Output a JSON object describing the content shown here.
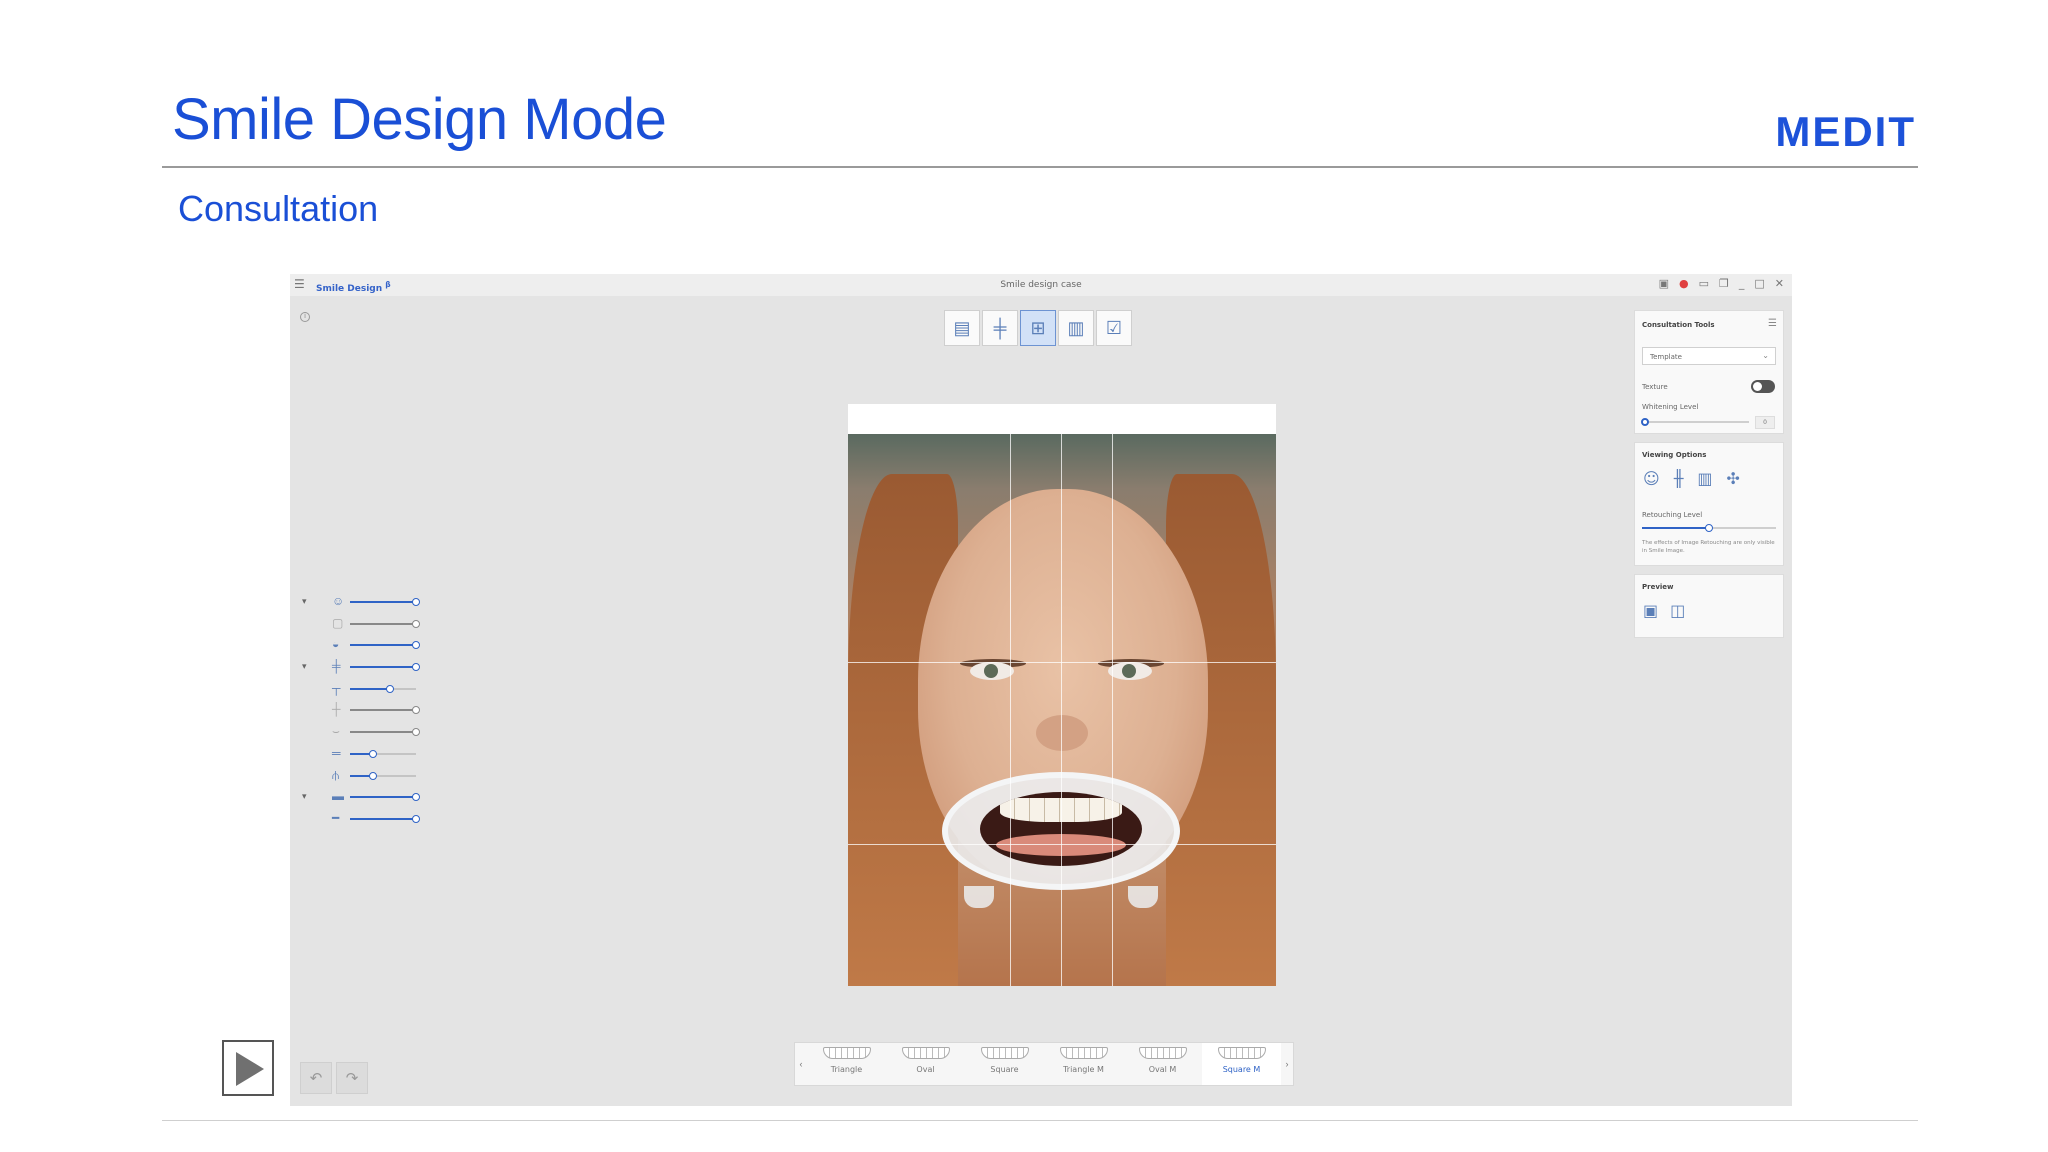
{
  "slide": {
    "title": "Smile Design Mode",
    "subtitle": "Consultation",
    "brand": "MEDIT"
  },
  "window": {
    "app_name": "Smile Design",
    "app_badge": "β",
    "document_title": "Smile design case",
    "controls": [
      "screenshot-icon",
      "record-icon",
      "fullscreen-icon",
      "restore-icon",
      "minimize-icon",
      "maximize-icon",
      "close-icon"
    ]
  },
  "toolbar": {
    "tools": [
      "photo-import-icon",
      "midline-icon",
      "smile-frame-icon",
      "teeth-library-icon",
      "checklist-icon"
    ],
    "active_index": 2
  },
  "left_sliders": [
    {
      "icon": "face-icon",
      "expander": true,
      "value": 1.0
    },
    {
      "icon": "outline-icon",
      "expander": false,
      "value": 1.0,
      "muted": true
    },
    {
      "icon": "lips-icon",
      "expander": false,
      "value": 1.0
    },
    {
      "icon": "midline-icon",
      "expander": true,
      "value": 1.0
    },
    {
      "icon": "vertical-guide-icon",
      "expander": false,
      "value": 0.6
    },
    {
      "icon": "cross-guide-icon",
      "expander": false,
      "value": 1.0,
      "muted": true
    },
    {
      "icon": "smile-curve-icon",
      "expander": false,
      "value": 1.0,
      "muted": true
    },
    {
      "icon": "incisal-line-icon",
      "expander": false,
      "value": 0.35
    },
    {
      "icon": "tooth-axis-icon",
      "expander": false,
      "value": 0.35
    },
    {
      "icon": "teeth-block-icon",
      "expander": true,
      "value": 1.0
    },
    {
      "icon": "bar-icon",
      "expander": false,
      "value": 1.0
    }
  ],
  "templates": {
    "items": [
      "Triangle",
      "Oval",
      "Square",
      "Triangle M",
      "Oval M",
      "Square M"
    ],
    "selected": "Square M"
  },
  "consultation_tools": {
    "title": "Consultation Tools",
    "template_select": "Template",
    "texture_label": "Texture",
    "texture_on": false,
    "whitening_label": "Whitening Level",
    "whitening_value": "0",
    "whitening_level": 0
  },
  "viewing_options": {
    "title": "Viewing Options",
    "icons": [
      "face-view-icon",
      "guide-view-icon",
      "teeth-view-icon",
      "extra-view-icon"
    ],
    "retouching_label": "Retouching Level",
    "retouching_level": 0.5,
    "note": "The effects of Image Retouching are only visible in Smile Image."
  },
  "preview": {
    "title": "Preview",
    "icons": [
      "preview-single-icon",
      "preview-compare-icon"
    ]
  }
}
